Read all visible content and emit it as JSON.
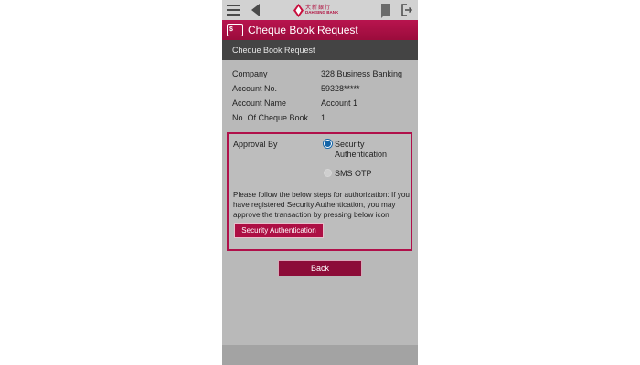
{
  "header": {
    "logo_line1": "大新銀行",
    "logo_line2": "DAH SING BANK",
    "menu_icon": "hamburger-icon",
    "back_icon": "back-arrow-icon",
    "flag_icon": "flag-icon",
    "logout_icon": "logout-icon"
  },
  "title": {
    "icon_text": "$",
    "text": "Cheque Book Request"
  },
  "subtitle": "Cheque Book Request",
  "details": [
    {
      "label": "Company",
      "value": "328 Business Banking"
    },
    {
      "label": "Account No.",
      "value": "59328*****"
    },
    {
      "label": "Account Name",
      "value": "Account 1"
    },
    {
      "label": "No. Of Cheque Book",
      "value": "1"
    }
  ],
  "approval": {
    "label": "Approval By",
    "option1": "Security Authentication",
    "option1_selected": true,
    "option2": "SMS OTP",
    "option2_selected": false,
    "instructions": "Please follow the below steps for authorization: If you have registered Security Authentication, you may approve the transaction by pressing below icon",
    "button": "Security Authentication"
  },
  "back_button": "Back",
  "colors": {
    "brand": "#a70f43",
    "selected_radio": "#1565a8"
  }
}
